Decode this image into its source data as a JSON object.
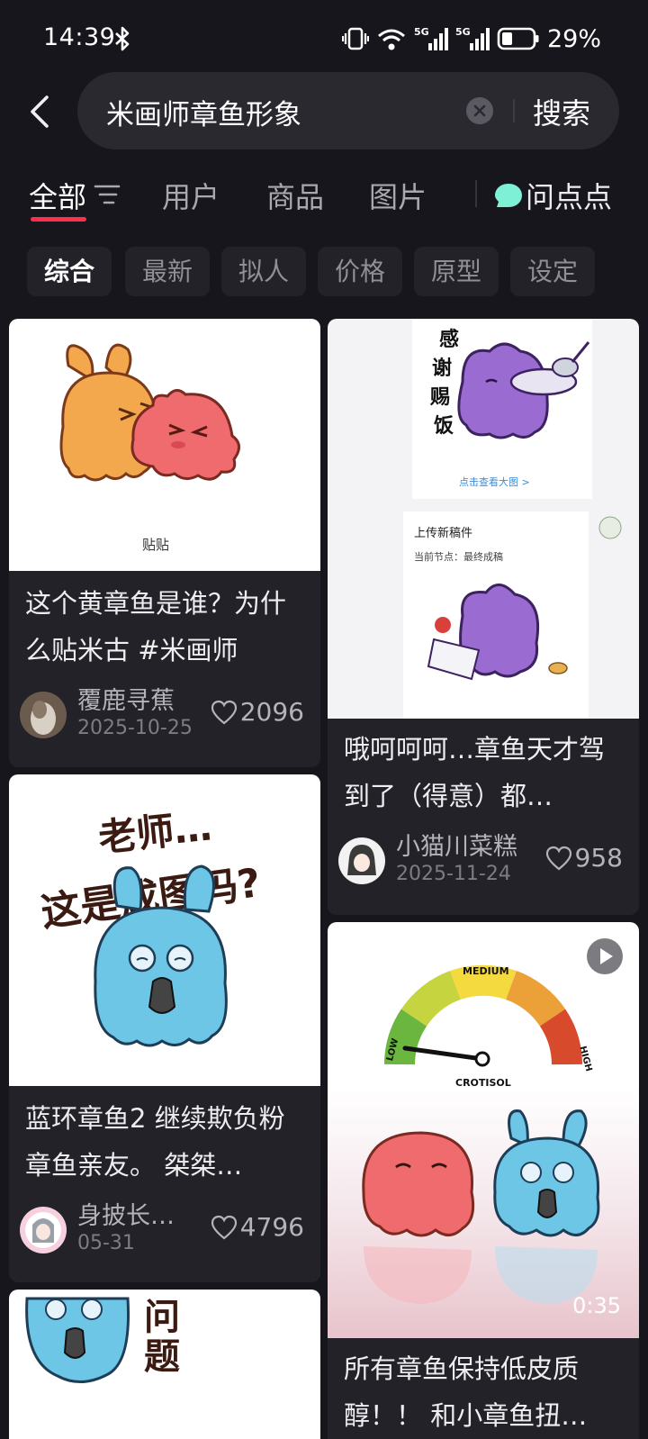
{
  "status_bar": {
    "time": "14:39",
    "battery": "29%"
  },
  "search": {
    "query": "米画师章鱼形象",
    "button": "搜索"
  },
  "tabs": [
    {
      "label": "全部"
    },
    {
      "label": "用户"
    },
    {
      "label": "商品"
    },
    {
      "label": "图片"
    },
    {
      "label": "问点点"
    }
  ],
  "chips": [
    "综合",
    "最新",
    "拟人",
    "价格",
    "原型",
    "设定"
  ],
  "cards": [
    {
      "image_caption": "贴贴",
      "title": "这个黄章鱼是谁？为什么贴米古 #米画师",
      "author": "覆鹿寻蕉",
      "date": "2025-10-25",
      "likes": "2096"
    },
    {
      "image_texts": {
        "v1": "感",
        "v2": "谢",
        "v3": "赐",
        "v4": "饭",
        "view": "点击查看大图 >",
        "upload": "上传新稿件",
        "node": "当前节点：最终成稿"
      },
      "title": "哦呵呵呵…章鱼天才驾到了（得意）都…",
      "author": "小猫川菜糕",
      "date": "2025-11-24",
      "likes": "958"
    },
    {
      "image_texts": {
        "line1": "老师…",
        "line2": "这是成图吗?"
      },
      "title": "蓝环章鱼2 继续欺负粉章鱼亲友。 桀桀…",
      "author": "身披长…",
      "date": "05-31",
      "likes": "4796"
    },
    {
      "image_texts": {
        "medium": "MEDIUM",
        "low": "LOW",
        "high": "HIGH",
        "gauge": "CROTISOL"
      },
      "duration": "0:35",
      "title": "所有章鱼保持低皮质醇！！ 和小章鱼扭…"
    },
    {
      "image_texts": {
        "t1": "问",
        "t2": "题"
      }
    }
  ],
  "colors": {
    "accent": "#ff2e4d",
    "background": "#17161c",
    "card": "#232228"
  }
}
